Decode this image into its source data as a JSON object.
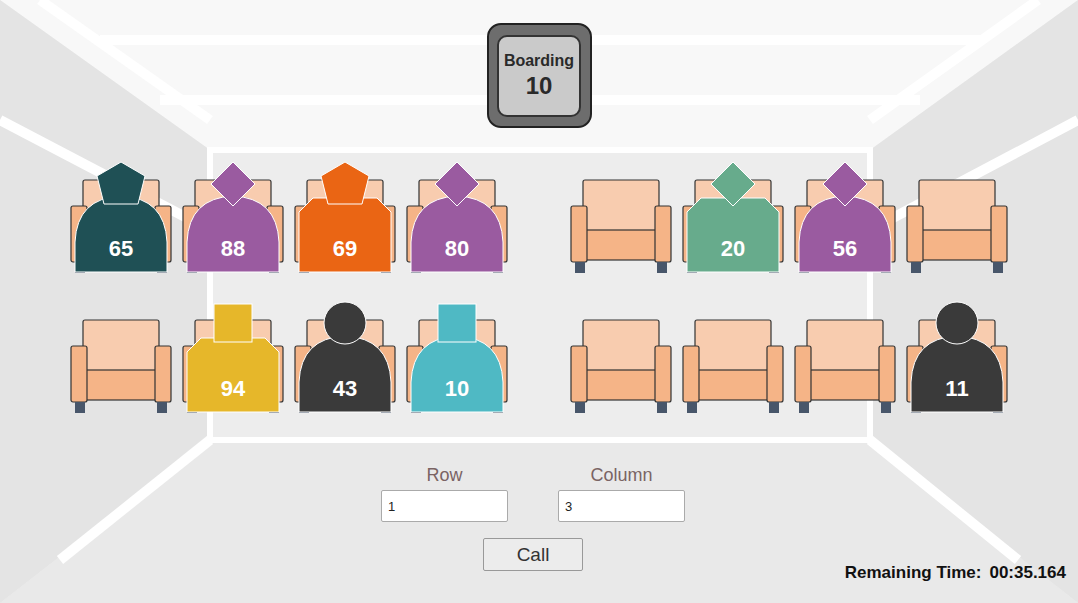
{
  "boarding": {
    "label": "Boarding",
    "number": "10"
  },
  "seat_rows": [
    {
      "left": [
        {
          "occupied": true,
          "passenger": {
            "number": "65",
            "color": "#1f5055",
            "kind": "pentagon",
            "body": "arch"
          }
        },
        {
          "occupied": true,
          "passenger": {
            "number": "88",
            "color": "#9a5ba0",
            "kind": "diamond",
            "body": "arch"
          }
        },
        {
          "occupied": true,
          "passenger": {
            "number": "69",
            "color": "#ea6514",
            "kind": "pentagon",
            "body": "block"
          }
        },
        {
          "occupied": true,
          "passenger": {
            "number": "80",
            "color": "#9a5ba0",
            "kind": "diamond",
            "body": "arch"
          }
        }
      ],
      "right": [
        {
          "occupied": false
        },
        {
          "occupied": true,
          "passenger": {
            "number": "20",
            "color": "#67ab8c",
            "kind": "diamond",
            "body": "block"
          }
        },
        {
          "occupied": true,
          "passenger": {
            "number": "56",
            "color": "#9a5ba0",
            "kind": "diamond",
            "body": "arch"
          }
        },
        {
          "occupied": false
        }
      ]
    },
    {
      "left": [
        {
          "occupied": false
        },
        {
          "occupied": true,
          "passenger": {
            "number": "94",
            "color": "#e6b72a",
            "kind": "square",
            "body": "block"
          }
        },
        {
          "occupied": true,
          "passenger": {
            "number": "43",
            "color": "#3a3a3a",
            "kind": "circle",
            "body": "arch"
          }
        },
        {
          "occupied": true,
          "passenger": {
            "number": "10",
            "color": "#4fb9c4",
            "kind": "square",
            "body": "arch"
          }
        }
      ],
      "right": [
        {
          "occupied": false
        },
        {
          "occupied": false
        },
        {
          "occupied": false
        },
        {
          "occupied": true,
          "passenger": {
            "number": "11",
            "color": "#3a3a3a",
            "kind": "circle",
            "body": "arch"
          }
        }
      ]
    }
  ],
  "form": {
    "fields": [
      {
        "label": "Row",
        "value": "1"
      },
      {
        "label": "Column",
        "value": "3"
      }
    ],
    "button": "Call"
  },
  "timer": {
    "label": "Remaining Time:",
    "value": "00:35.164"
  }
}
